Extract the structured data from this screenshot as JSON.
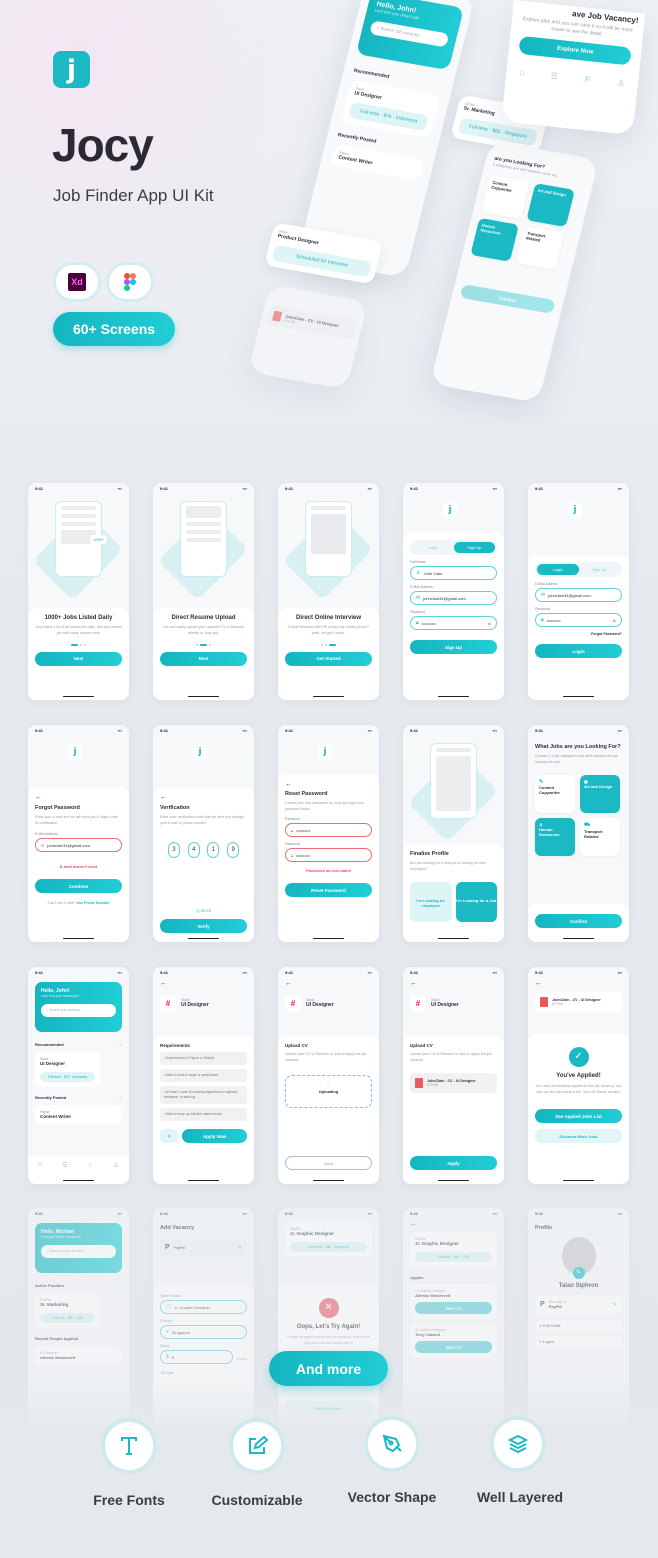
{
  "hero": {
    "logo_letter": "j",
    "title": "Jocy",
    "subtitle": "Job Finder App UI Kit",
    "tools": [
      "Xd",
      "Figma"
    ],
    "screens_badge": "60+ Screens",
    "phone_home": {
      "greeting": "Hello, John!",
      "sub": "Let's find your dream job!",
      "search": "Search job vacancy",
      "recommended": "Recommended",
      "company": "Slack",
      "job": "UI Designer",
      "tag": "Full-time · $7k · Indonesia",
      "recent": "Recently Posted",
      "company2": "Figma",
      "job2": "Content Writer"
    },
    "tiktok": {
      "company": "TikTok",
      "job": "Sr. Marketing",
      "tag": "Full-time · $6k · Singapore"
    },
    "stripe": {
      "company": "Stripe",
      "job": "Product Designer",
      "tag": "Scheduled for Interview"
    },
    "save": {
      "title": "ave Job Vacancy!",
      "desc": "Explore jobs and you can save it so it will be more easier to see the detail.",
      "button": "Explore Now"
    },
    "cats": {
      "title": "are you Looking For?",
      "desc": "b categories and we'll optimize cy for you.",
      "items": [
        "Content Copywriter",
        "Art and Design",
        "Human Resources",
        "Transport Related"
      ],
      "button": "Confirm"
    },
    "cv": {
      "name": "JohnClain - CV - UI Designer",
      "size": "670 Kb"
    }
  },
  "status_time": "9:41",
  "onboard": [
    {
      "title": "1000+ Jobs Listed Daily",
      "desc": "Jocy listed a lot of job vacancies daily. find your dream job with many choices now.",
      "button": "Next",
      "badge": "1000+"
    },
    {
      "title": "Direct Resume Upload",
      "desc": "You can easily upload your updated CV or Resume directly in Jocy app.",
      "button": "Next"
    },
    {
      "title": "Direct Online Interview",
      "desc": "Online interview with HR using only mobile phone? yeah, we got it cover.",
      "button": "Get Started"
    }
  ],
  "auth": {
    "login": "Login",
    "signup": "Sign Up",
    "full_name_label": "Full Name",
    "full_name": "John Clain",
    "email_label": "E-Mail Address",
    "email": "johnclain34@gmail.com",
    "password_label": "Password",
    "password": "••••••••••",
    "forgot": "Forgot Password?"
  },
  "forgot": {
    "title": "Forgot Password",
    "desc": "Enter your e-mail and we will send you 4 digits code for verification.",
    "error": "E-mail doesn't exist",
    "button": "Continue",
    "alt": "Can't use e-mail?",
    "alt_link": "Use Phone Number"
  },
  "verify": {
    "title": "Verification",
    "desc": "Enter your verification code that we sent you through your e-mail or phone number.",
    "digits": [
      "3",
      "4",
      "1",
      "9"
    ],
    "timer": "00:49",
    "button": "Verify"
  },
  "reset": {
    "title": "Reset Password",
    "desc": "Create your new password for Jocy and type new password twice.",
    "error": "Password do not match",
    "button": "Reset Password"
  },
  "finalize": {
    "title": "Finalize Profile",
    "desc": "Are you looking for a new job or looking for new employee?",
    "opt1": "I'm Looking for employee",
    "opt2": "I'm Looking for a Job"
  },
  "categories": {
    "title": "What Jobs are you Looking For?",
    "desc": "Choose 2-4 job categories and we'll optimize the job vacancy for you.",
    "items": [
      "Content Copywriter",
      "Art and Design",
      "Human Resources",
      "Transport Related"
    ],
    "button": "Confirm"
  },
  "home": {
    "greeting": "Hello, John!",
    "sub": "Let's find your dream job!",
    "search": "Search job vacancy",
    "recommended": "Recommended",
    "company": "Slack",
    "job": "UI Designer",
    "tag": "Full-time · $7k · Indonesia",
    "recent": "Recently Posted",
    "company2": "Figma",
    "job2": "Content Writer"
  },
  "detail": {
    "company": "Slack",
    "job": "UI Designer",
    "req_title": "Requirements",
    "reqs": [
      "Experienced in Figma or Sketch.",
      "Able to work in large or small team.",
      "At least 1 year of working experience in agency, freelance, or start-up.",
      "Able to keep up with the latest trends."
    ],
    "apply_now": "Apply Now"
  },
  "upload": {
    "title": "Upload CV",
    "desc": "Upload your CV or Resume in Jocy to apply the job vacancy.",
    "uploading": "Uploading",
    "apply": "Apply",
    "file": "JohnClain - CV - UI Designer",
    "size": "670 Kb"
  },
  "applied": {
    "title": "You've Applied!",
    "desc": "You have successfully applied to this job vacancy. You can see the job status in the 'Job List Status' section.",
    "btn1": "See Applied Jobs List",
    "btn2": "Discover More Jobs"
  },
  "recruiter": {
    "greeting": "Hello, Michael",
    "sub": "Find your active vacancies",
    "search": "Search active position",
    "active": "Active Position",
    "company": "PayPal",
    "job": "Sr. Marketing",
    "tag": "Full-time · $5k · USA",
    "recent": "Recent People Applied",
    "person_role": "UI Designer",
    "person": "Alfredo Westervelt"
  },
  "add_vacancy": {
    "title": "Add Vacancy",
    "company": "PayPal",
    "pos_label": "Open Position",
    "pos": "Jr. Graphic Designer",
    "country_label": "Country",
    "country": "Singapore",
    "salary_label": "Salary",
    "salary": "8",
    "unit": "K/year",
    "type_label": "Job Type"
  },
  "oops": {
    "company": "PayPal",
    "job": "Jr. Graphic Designer",
    "tag": "Freelance · $8k · Singapore",
    "title": "Oops, Let's Try Again!",
    "desc": "Please try again to post this job vacancy, make sure that your internet connection is",
    "back": "Back to Home"
  },
  "appliers": {
    "company": "PayPal",
    "job": "Jr. Graphic Designer",
    "tag": "Full-time · $8k · USA",
    "title": "Applier",
    "role": "Jr. Graphic Designer",
    "p1": "Alfredo Westervelt",
    "p2": "Terry Calzoni",
    "see_cv": "See CV"
  },
  "profile": {
    "title": "Profile",
    "name": "Talan Siphron",
    "recruiter_at": "Recruiter at",
    "company": "PayPal",
    "edit": "Edit Profile",
    "logout": "Logout"
  },
  "and_more": "And more",
  "features": [
    "Free Fonts",
    "Customizable",
    "Vector Shape",
    "Well Layered"
  ],
  "colors": {
    "accent": "#1ab9c3",
    "error": "#ef6b7a"
  }
}
